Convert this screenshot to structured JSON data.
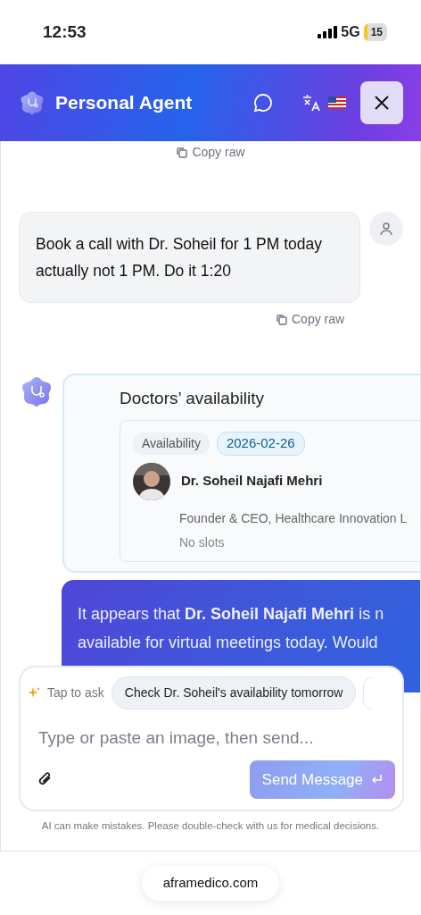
{
  "status_bar": {
    "time": "12:53",
    "network": "5G",
    "battery": "15"
  },
  "header": {
    "title": "Personal Agent"
  },
  "chat": {
    "top_copy": "Copy raw",
    "messages": [
      {
        "kind": "user",
        "text": "Book a call with Dr. Soheil for 1 PM today actually not 1 PM. Do it 1:20",
        "copy": "Copy raw"
      },
      {
        "kind": "availability",
        "title": "Doctors’ availability",
        "tag": "Availability",
        "date": "2026-02-26",
        "doctor": {
          "name": "Dr. Soheil Najafi Mehri",
          "role": "Founder & CEO, Healthcare Innovation L",
          "slots": "No slots"
        }
      },
      {
        "kind": "assistant",
        "lines": [
          "It appears that **Dr. Soheil Najafi Mehri** is n",
          "available for virtual meetings today. Would"
        ]
      }
    ]
  },
  "composer": {
    "suggest_label": "Tap to ask",
    "suggestions": [
      "Check Dr. Soheil's availability tomorrow"
    ],
    "placeholder": "Type or paste an image, then send...",
    "send": {
      "label": "Send Message",
      "disabled": true
    },
    "disclaimer": "AI can make mistakes. Please double-check with us for medical decisions."
  },
  "browser": {
    "url": "aframedico.com"
  }
}
